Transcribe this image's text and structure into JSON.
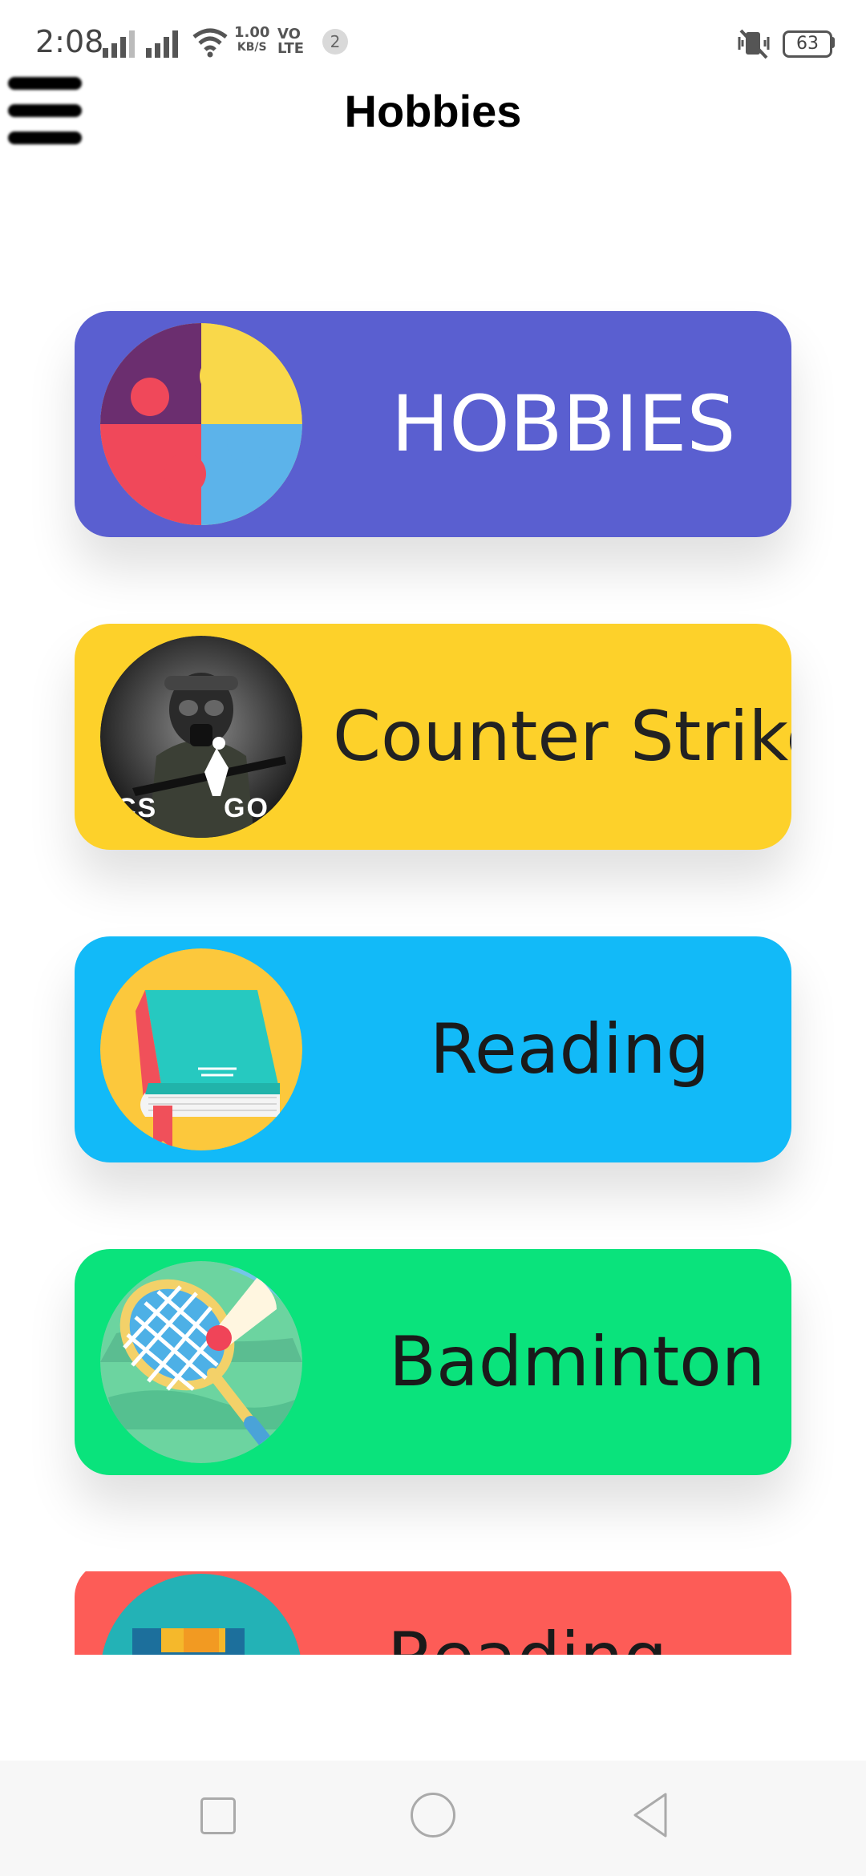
{
  "status_bar": {
    "time": "2:08",
    "network_speed_value": "1.00",
    "network_speed_unit": "KB/S",
    "volte_top": "VO",
    "volte_bottom": "LTE",
    "notification_count": "2",
    "battery_level": "63"
  },
  "app_bar": {
    "title": "Hobbies"
  },
  "cards": [
    {
      "label": "HOBBIES",
      "color": "#5a5fd0",
      "text_color": "#ffffff",
      "icon": "puzzle-icon"
    },
    {
      "label": "Counter Strike",
      "color": "#fdd12a",
      "text_color": "#222222",
      "icon": "csgo-soldier-icon"
    },
    {
      "label": "Reading",
      "color": "#12baf8",
      "text_color": "#1a1a1a",
      "icon": "book-icon"
    },
    {
      "label": "Badminton",
      "color": "#0ae37c",
      "text_color": "#1a1a1a",
      "icon": "badminton-icon"
    },
    {
      "label": "Reading",
      "color": "#fd5c57",
      "text_color": "#1a1a1a",
      "icon": "film-icon"
    }
  ],
  "icon_text": {
    "csgo_left": "CS",
    "csgo_right": "GO"
  }
}
